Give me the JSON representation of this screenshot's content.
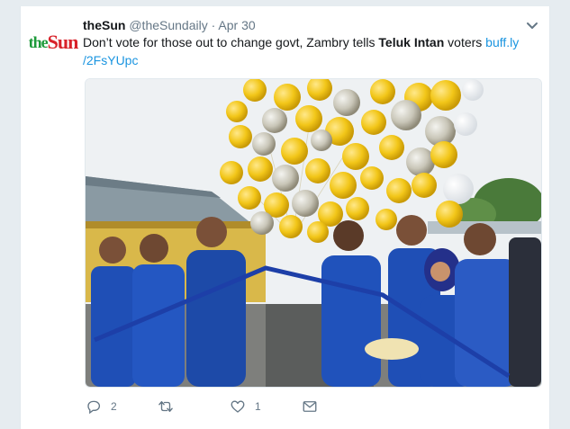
{
  "tweet": {
    "author_name": "theSun",
    "handle": "@theSundaily",
    "separator": "·",
    "date": "Apr 30",
    "text_part1": "Don’t vote for those out to change govt, Zambry tells ",
    "text_bold": "Teluk Intan",
    "text_part2": " voters ",
    "link_line1": "buff.ly",
    "link_line2": "/2FsYUpc",
    "logo_the": "the",
    "logo_sun": "Sun"
  },
  "actions": {
    "reply_count": "2",
    "retweet_count": "",
    "like_count": "1"
  },
  "icons": {
    "reply": "reply-icon",
    "retweet": "retweet-icon",
    "like": "like-icon",
    "dm": "mail-icon",
    "more": "chevron-down-icon"
  },
  "colors": {
    "link": "#1b95e0",
    "muted": "#657786",
    "text": "#14171a",
    "shirt_blue": "#1f4fb6",
    "balloon_yellow": "#f2c618"
  }
}
